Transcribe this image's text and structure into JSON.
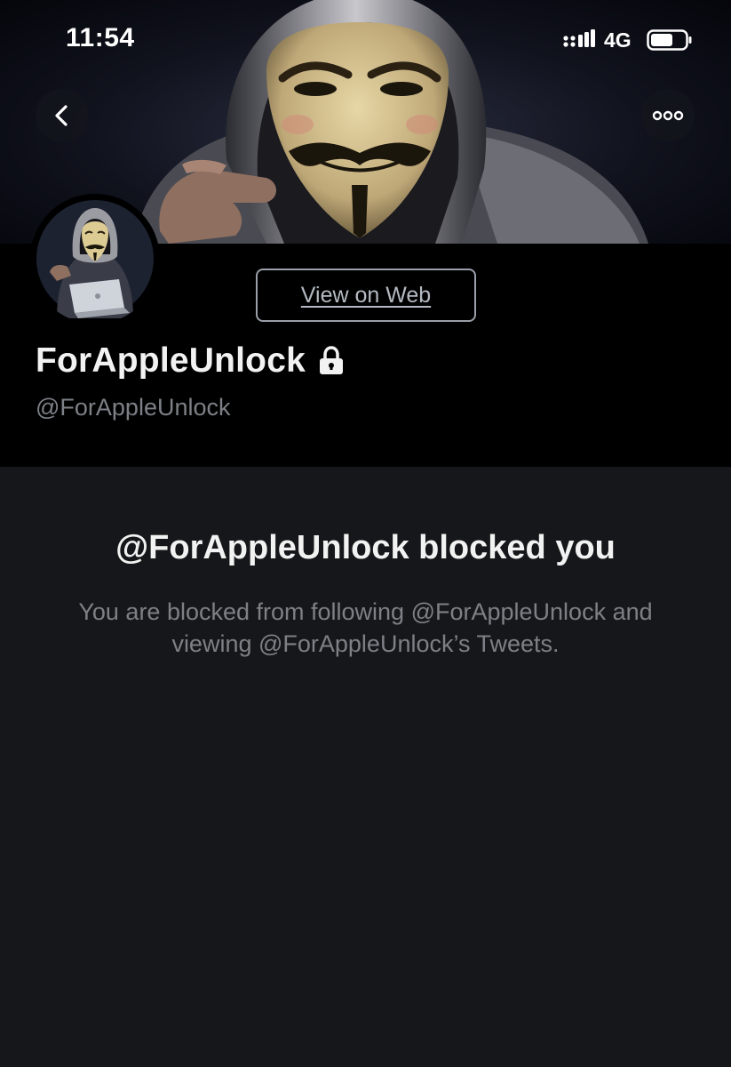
{
  "status_bar": {
    "time": "11:54",
    "network": "4G",
    "signal_icon": "signal-bars-icon",
    "battery_icon": "battery-icon"
  },
  "nav": {
    "back_icon": "chevron-left-icon",
    "more_icon": "more-horizontal-icon"
  },
  "profile": {
    "view_on_web_label": "View on Web",
    "display_name": "ForAppleUnlock",
    "handle": "@ForAppleUnlock",
    "protected_icon": "lock-icon"
  },
  "blocked": {
    "title": "@ForAppleUnlock blocked you",
    "description": "You are blocked from following @ForAppleUnlock and viewing @ForAppleUnlock’s Tweets."
  },
  "colors": {
    "background": "#16171a",
    "header_background": "#000000",
    "primary_text": "#f2f2f2",
    "secondary_text": "#7d8086",
    "button_border": "#9aa0a8"
  }
}
